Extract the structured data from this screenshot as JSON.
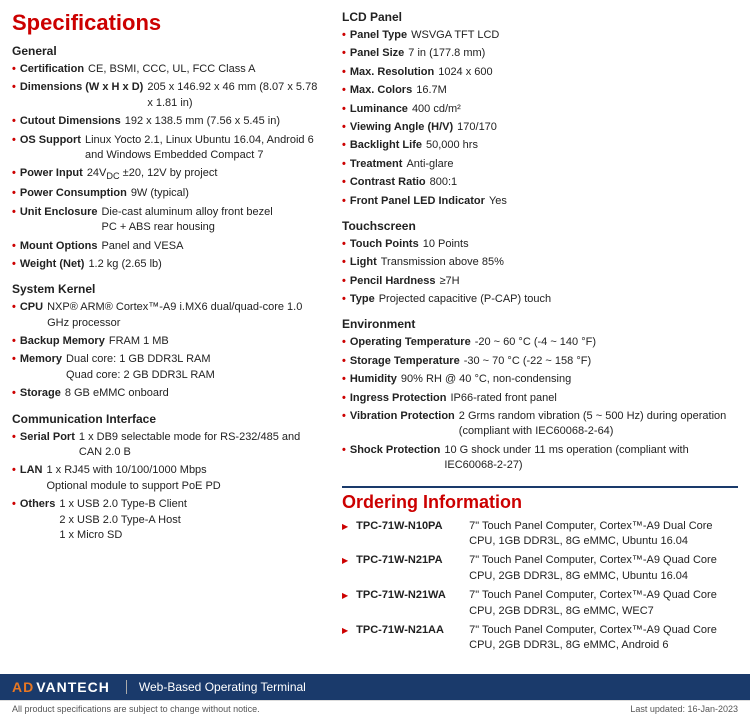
{
  "page": {
    "title": "Specifications"
  },
  "left": {
    "general": {
      "title": "General",
      "items": [
        {
          "label": "Certification",
          "value": "CE, BSMI, CCC, UL, FCC Class A"
        },
        {
          "label": "Dimensions (W x H x D)",
          "value": "205 x 146.92 x 46 mm (8.07 x 5.78 x 1.81 in)"
        },
        {
          "label": "Cutout Dimensions",
          "value": "192 x 138.5 mm (7.56 x 5.45 in)"
        },
        {
          "label": "OS Support",
          "value": "Linux Yocto 2.1, Linux Ubuntu 16.04, Android 6 and Windows Embedded Compact 7"
        },
        {
          "label": "Power Input",
          "value": "24V DC ±20, 12V by project"
        },
        {
          "label": "Power Consumption",
          "value": "9W (typical)"
        },
        {
          "label": "Unit Enclosure",
          "value": "Die-cast aluminum alloy front bezel\nPC + ABS rear housing"
        },
        {
          "label": "Mount Options",
          "value": "Panel and VESA"
        },
        {
          "label": "Weight (Net)",
          "value": "1.2 kg (2.65 lb)"
        }
      ]
    },
    "system_kernel": {
      "title": "System Kernel",
      "items": [
        {
          "label": "CPU",
          "value": "NXP® ARM® Cortex™-A9 i.MX6 dual/quad-core 1.0 GHz processor"
        },
        {
          "label": "Backup Memory",
          "value": "FRAM 1 MB"
        },
        {
          "label": "Memory",
          "value": "Dual core: 1 GB DDR3L RAM\nQuad core: 2 GB DDR3L RAM"
        },
        {
          "label": "Storage",
          "value": "8 GB eMMC onboard"
        }
      ]
    },
    "communication": {
      "title": "Communication Interface",
      "items": [
        {
          "label": "Serial Port",
          "value": "1 x DB9 selectable mode for RS-232/485 and CAN 2.0 B"
        },
        {
          "label": "LAN",
          "value": "1 x RJ45 with 10/100/1000 Mbps\nOptional module to support PoE PD"
        },
        {
          "label": "Others",
          "value": "1 x USB 2.0 Type-B Client\n2 x USB 2.0 Type-A Host\n1 x Micro SD"
        }
      ]
    }
  },
  "right": {
    "lcd": {
      "title": "LCD Panel",
      "items": [
        {
          "label": "Panel Type",
          "value": "WSVGA TFT LCD"
        },
        {
          "label": "Panel Size",
          "value": "7 in (177.8 mm)"
        },
        {
          "label": "Max. Resolution",
          "value": "1024 x 600"
        },
        {
          "label": "Max. Colors",
          "value": "16.7M"
        },
        {
          "label": "Luminance",
          "value": "400 cd/m²"
        },
        {
          "label": "Viewing Angle (H/V)",
          "value": "170/170"
        },
        {
          "label": "Backlight Life",
          "value": "50,000 hrs"
        },
        {
          "label": "Treatment",
          "value": "Anti-glare"
        },
        {
          "label": "Contrast Ratio",
          "value": "800:1"
        },
        {
          "label": "Front Panel LED Indicator",
          "value": "Yes"
        }
      ]
    },
    "touchscreen": {
      "title": "Touchscreen",
      "items": [
        {
          "label": "Touch Points",
          "value": "10 Points"
        },
        {
          "label": "Light",
          "value": "Transmission above 85%"
        },
        {
          "label": "Pencil Hardness",
          "value": "≥7H"
        },
        {
          "label": "Type",
          "value": "Projected capacitive (P-CAP) touch"
        }
      ]
    },
    "environment": {
      "title": "Environment",
      "items": [
        {
          "label": "Operating Temperature",
          "value": "-20 ~ 60 °C (-4 ~ 140 °F)"
        },
        {
          "label": "Storage Temperature",
          "value": "-30 ~ 70 °C (-22 ~ 158 °F)"
        },
        {
          "label": "Humidity",
          "value": "90% RH @ 40 °C, non-condensing"
        },
        {
          "label": "Ingress Protection",
          "value": "IP66-rated front panel"
        },
        {
          "label": "Vibration Protection",
          "value": "2 Grms random vibration (5 ~ 500 Hz) during operation (compliant with IEC60068-2-64)"
        },
        {
          "label": "Shock Protection",
          "value": "10 G shock under 11 ms operation (compliant with IEC60068-2-27)"
        }
      ]
    }
  },
  "ordering": {
    "title": "Ordering Information",
    "items": [
      {
        "label": "TPC-71W-N10PA",
        "value": "7\" Touch Panel Computer, Cortex™-A9 Dual Core CPU, 1GB DDR3L, 8G eMMC, Ubuntu 16.04"
      },
      {
        "label": "TPC-71W-N21PA",
        "value": "7\" Touch Panel Computer, Cortex™-A9 Quad Core CPU, 2GB DDR3L, 8G eMMC, Ubuntu 16.04"
      },
      {
        "label": "TPC-71W-N21WA",
        "value": "7\" Touch Panel Computer, Cortex™-A9 Quad Core CPU, 2GB DDR3L, 8G eMMC, WEC7"
      },
      {
        "label": "TPC-71W-N21AA",
        "value": "7\" Touch Panel Computer, Cortex™-A9 Quad Core CPU, 2GB DDR3L, 8G eMMC, Android 6"
      }
    ]
  },
  "footer": {
    "logo_ad": "AD",
    "logo_vantech": "VANTECH",
    "subtitle": "Web-Based Operating Terminal",
    "note_left": "All product specifications are subject to change without notice.",
    "note_right": "Last updated: 16-Jan-2023"
  }
}
